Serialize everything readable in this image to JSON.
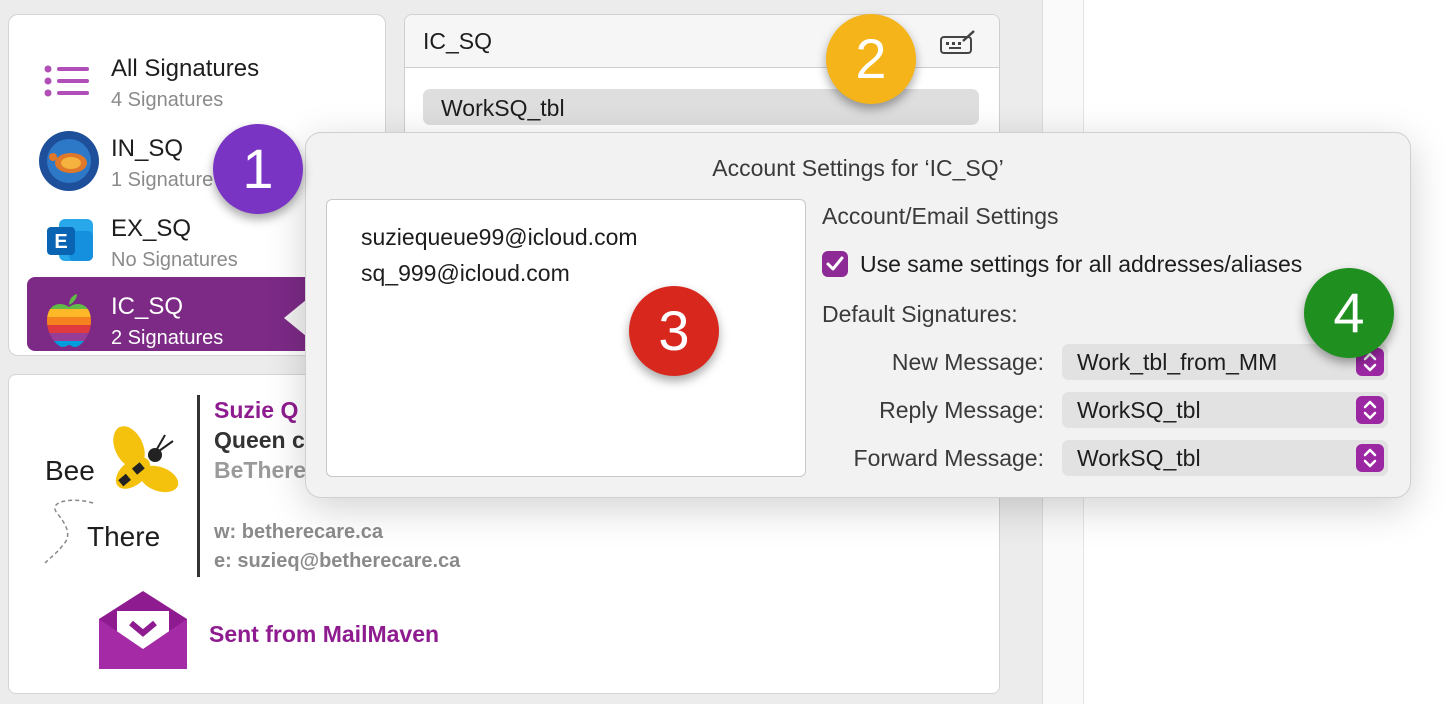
{
  "accounts": [
    {
      "name": "All Signatures",
      "sub": "4 Signatures"
    },
    {
      "name": "IN_SQ",
      "sub": "1 Signature"
    },
    {
      "name": "EX_SQ",
      "sub": "No Signatures"
    },
    {
      "name": "IC_SQ",
      "sub": "2 Signatures"
    }
  ],
  "signature_list": {
    "header": "IC_SQ",
    "items": [
      "WorkSQ_tbl"
    ]
  },
  "preview": {
    "logo_top": "Bee",
    "logo_bottom": "There",
    "name": "Suzie Q",
    "title": "Queen c",
    "company": "BeThere",
    "website": "w: betherecare.ca",
    "email": "e: suzieq@betherecare.ca",
    "sent_from": "Sent from MailMaven"
  },
  "popover": {
    "title": "Account Settings for ‘IC_SQ’",
    "addresses": [
      "suziequeue99@icloud.com",
      "sq_999@icloud.com"
    ],
    "section_title": "Account/Email Settings",
    "checkbox_label": "Use same settings for all addresses/aliases",
    "checkbox_checked": true,
    "default_label": "Default Signatures:",
    "fields": [
      {
        "label": "New Message:",
        "value": "Work_tbl_from_MM"
      },
      {
        "label": "Reply Message:",
        "value": "WorkSQ_tbl"
      },
      {
        "label": "Forward Message:",
        "value": "WorkSQ_tbl"
      }
    ]
  },
  "badges": [
    {
      "text": "1",
      "color": "#7a34c4"
    },
    {
      "text": "2",
      "color": "#f4b41a"
    },
    {
      "text": "3",
      "color": "#d8281e"
    },
    {
      "text": "4",
      "color": "#1f8f1f"
    }
  ],
  "colors": {
    "accent": "#7c2a86",
    "stepper": "#9b27a3"
  }
}
